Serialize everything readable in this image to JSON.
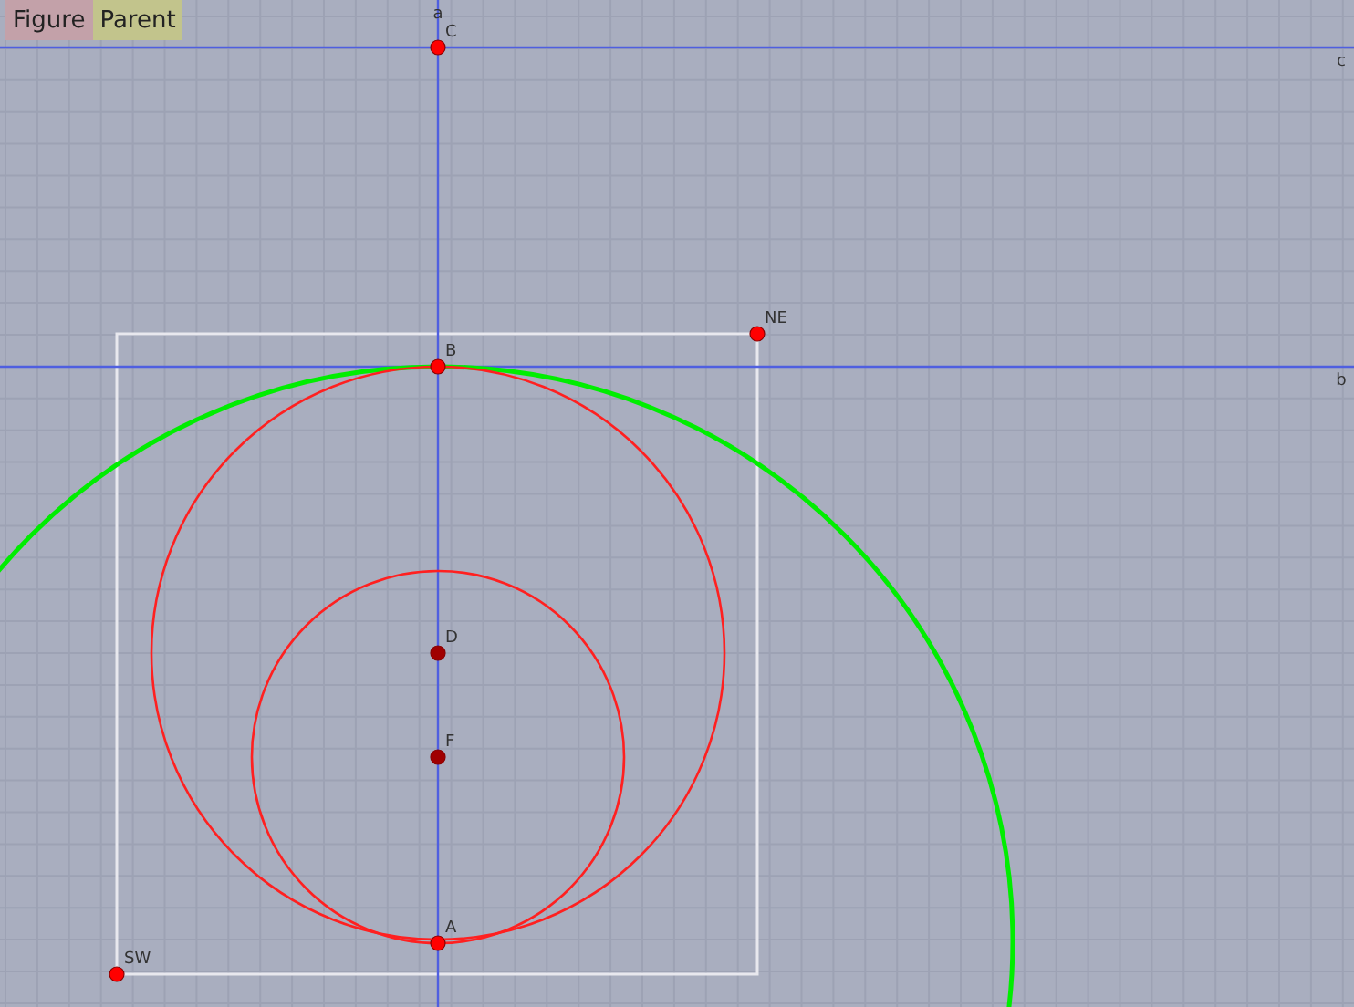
{
  "toolbar": {
    "buttons": [
      {
        "label": "Figure",
        "kind": "figure"
      },
      {
        "label": "Parent",
        "kind": "parent"
      }
    ]
  },
  "lines": [
    {
      "label": "a"
    },
    {
      "label": "c"
    },
    {
      "label": "b"
    }
  ],
  "points": [
    {
      "label": "C",
      "kind": "free"
    },
    {
      "label": "B",
      "kind": "free"
    },
    {
      "label": "D",
      "kind": "dependent"
    },
    {
      "label": "F",
      "kind": "dependent"
    },
    {
      "label": "A",
      "kind": "free"
    },
    {
      "label": "NE",
      "kind": "free"
    },
    {
      "label": "SW",
      "kind": "free"
    }
  ]
}
